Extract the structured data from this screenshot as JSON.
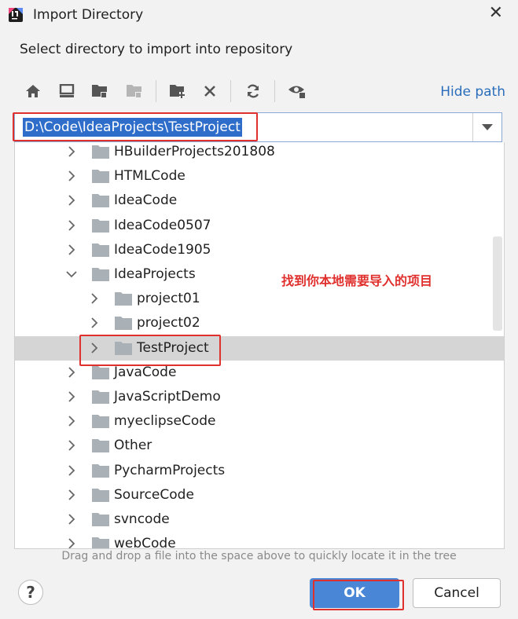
{
  "window": {
    "title": "Import Directory",
    "close_icon": "close-icon"
  },
  "subtitle": "Select directory to import into repository",
  "toolbar": {
    "buttons": [
      "home-icon",
      "desktop-icon",
      "project-folder-icon",
      "module-folder-icon",
      "new-folder-icon",
      "delete-icon",
      "refresh-icon",
      "show-hidden-icon"
    ],
    "hide_path": "Hide path"
  },
  "path": {
    "value": "D:\\Code\\IdeaProjects\\TestProject"
  },
  "tree": {
    "rows": [
      {
        "label": "HBuilderProjects201808",
        "expanded": false
      },
      {
        "label": "HTMLCode",
        "expanded": false
      },
      {
        "label": "IdeaCode",
        "expanded": false
      },
      {
        "label": "IdeaCode0507",
        "expanded": false
      },
      {
        "label": "IdeaCode1905",
        "expanded": false
      },
      {
        "label": "IdeaProjects",
        "expanded": true
      },
      {
        "label": "project01",
        "expanded": false
      },
      {
        "label": "project02",
        "expanded": false
      },
      {
        "label": "TestProject",
        "expanded": false,
        "selected": true
      },
      {
        "label": "JavaCode",
        "expanded": false
      },
      {
        "label": "JavaScriptDemo",
        "expanded": false
      },
      {
        "label": "myeclipseCode",
        "expanded": false
      },
      {
        "label": "Other",
        "expanded": false
      },
      {
        "label": "PycharmProjects",
        "expanded": false
      },
      {
        "label": "SourceCode",
        "expanded": false
      },
      {
        "label": "svncode",
        "expanded": false
      },
      {
        "label": "webCode",
        "expanded": false
      }
    ]
  },
  "annotation": "找到你本地需要导入的项目",
  "hint": "Drag and drop a file into the space above to quickly locate it in the tree",
  "footer": {
    "help": "?",
    "ok": "OK",
    "cancel": "Cancel"
  },
  "colors": {
    "accent": "#4a86d6",
    "link": "#2a6ebb",
    "highlight": "#e0302e",
    "selection": "#d5d5d5",
    "folder": "#a9b0b6"
  }
}
